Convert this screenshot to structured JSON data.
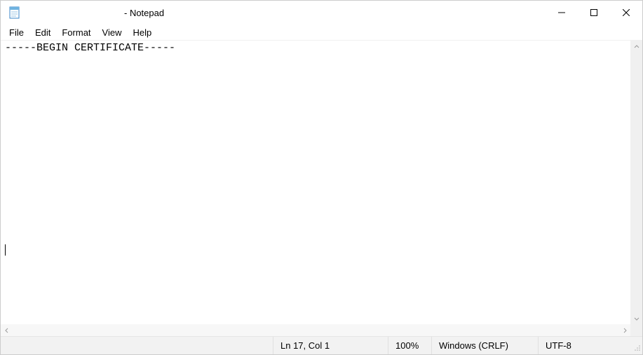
{
  "titlebar": {
    "title": " - Notepad"
  },
  "menu": {
    "file": "File",
    "edit": "Edit",
    "format": "Format",
    "view": "View",
    "help": "Help"
  },
  "editor": {
    "content": "-----BEGIN CERTIFICATE-----\n\n\n\n\n\n\n\n\n\n\n\n\n\n\n\n"
  },
  "status": {
    "position": "Ln 17, Col 1",
    "zoom": "100%",
    "line_ending": "Windows (CRLF)",
    "encoding": "UTF-8"
  },
  "icons": {
    "notepad": "notepad-icon",
    "minimize": "minimize-icon",
    "maximize": "maximize-icon",
    "close": "close-icon"
  }
}
